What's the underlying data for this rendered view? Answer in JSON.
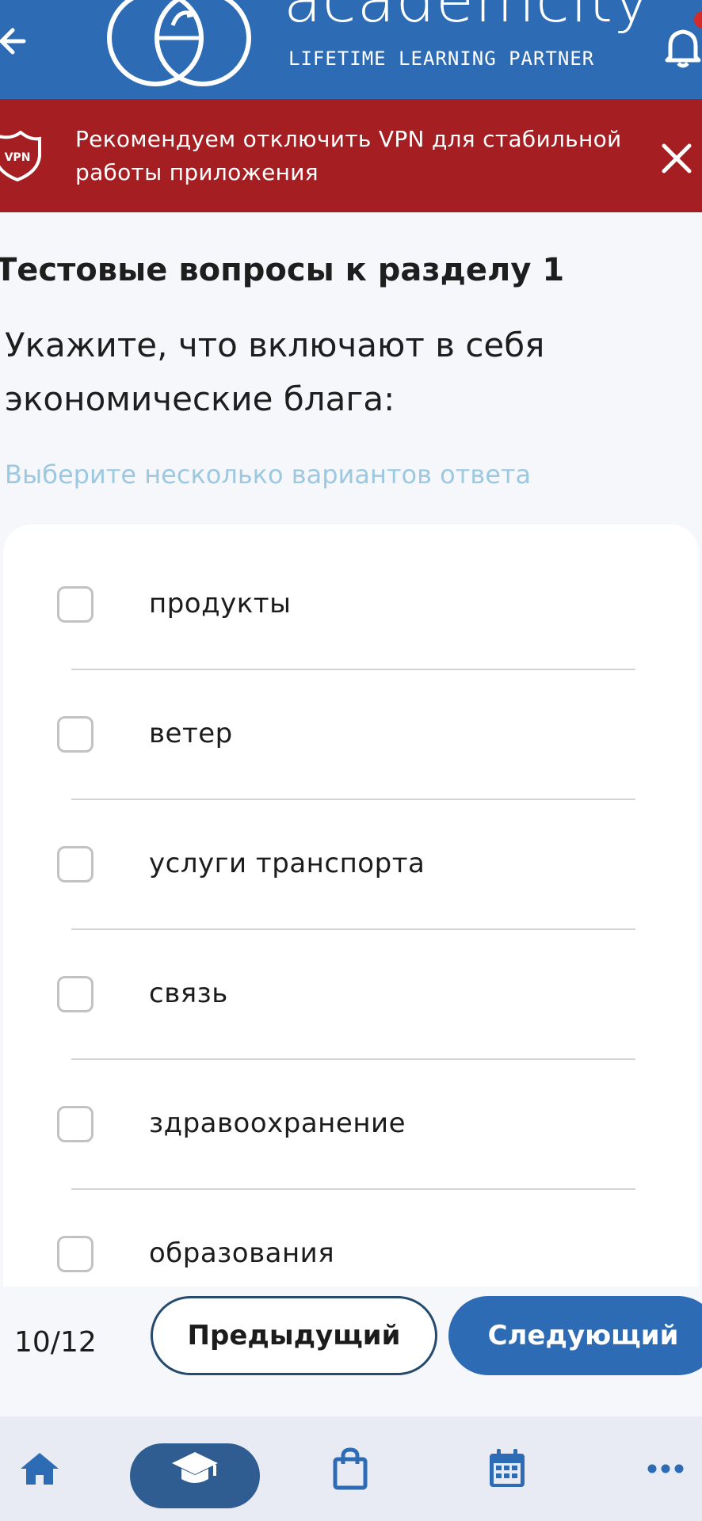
{
  "header": {
    "brand_name": "academcity",
    "tagline": "LIFETIME LEARNING PARTNER",
    "background_color": "#2d6cb5",
    "icons": [
      "back-arrow-icon",
      "logo-icon",
      "bell-icon"
    ]
  },
  "vpn_banner": {
    "badge": "VPN",
    "message": "Рекомендуем отключить VPN для стабильной работы приложения",
    "background_color": "#a51f22",
    "icons": [
      "shield-icon",
      "close-icon"
    ]
  },
  "quiz": {
    "section_title": "Тестовые вопросы к разделу 1",
    "question": "Укажите, что включают в себя экономические блага:",
    "hint": "Выберите несколько вариантов ответа",
    "options": [
      {
        "label": "продукты",
        "checked": false
      },
      {
        "label": "ветер",
        "checked": false
      },
      {
        "label": "услуги транспорта",
        "checked": false
      },
      {
        "label": "связь",
        "checked": false
      },
      {
        "label": "здравоохранение",
        "checked": false
      },
      {
        "label": "образования",
        "checked": false
      }
    ]
  },
  "pager": {
    "counter": "10/12",
    "prev_label": "Предыдущий",
    "next_label": "Следующий",
    "accent_color": "#2d6cb5"
  },
  "bottom_nav": {
    "items": [
      "home-icon",
      "courses-icon",
      "shopping-bag-icon",
      "calendar-icon",
      "more-icon"
    ],
    "active_item": "courses-icon"
  }
}
